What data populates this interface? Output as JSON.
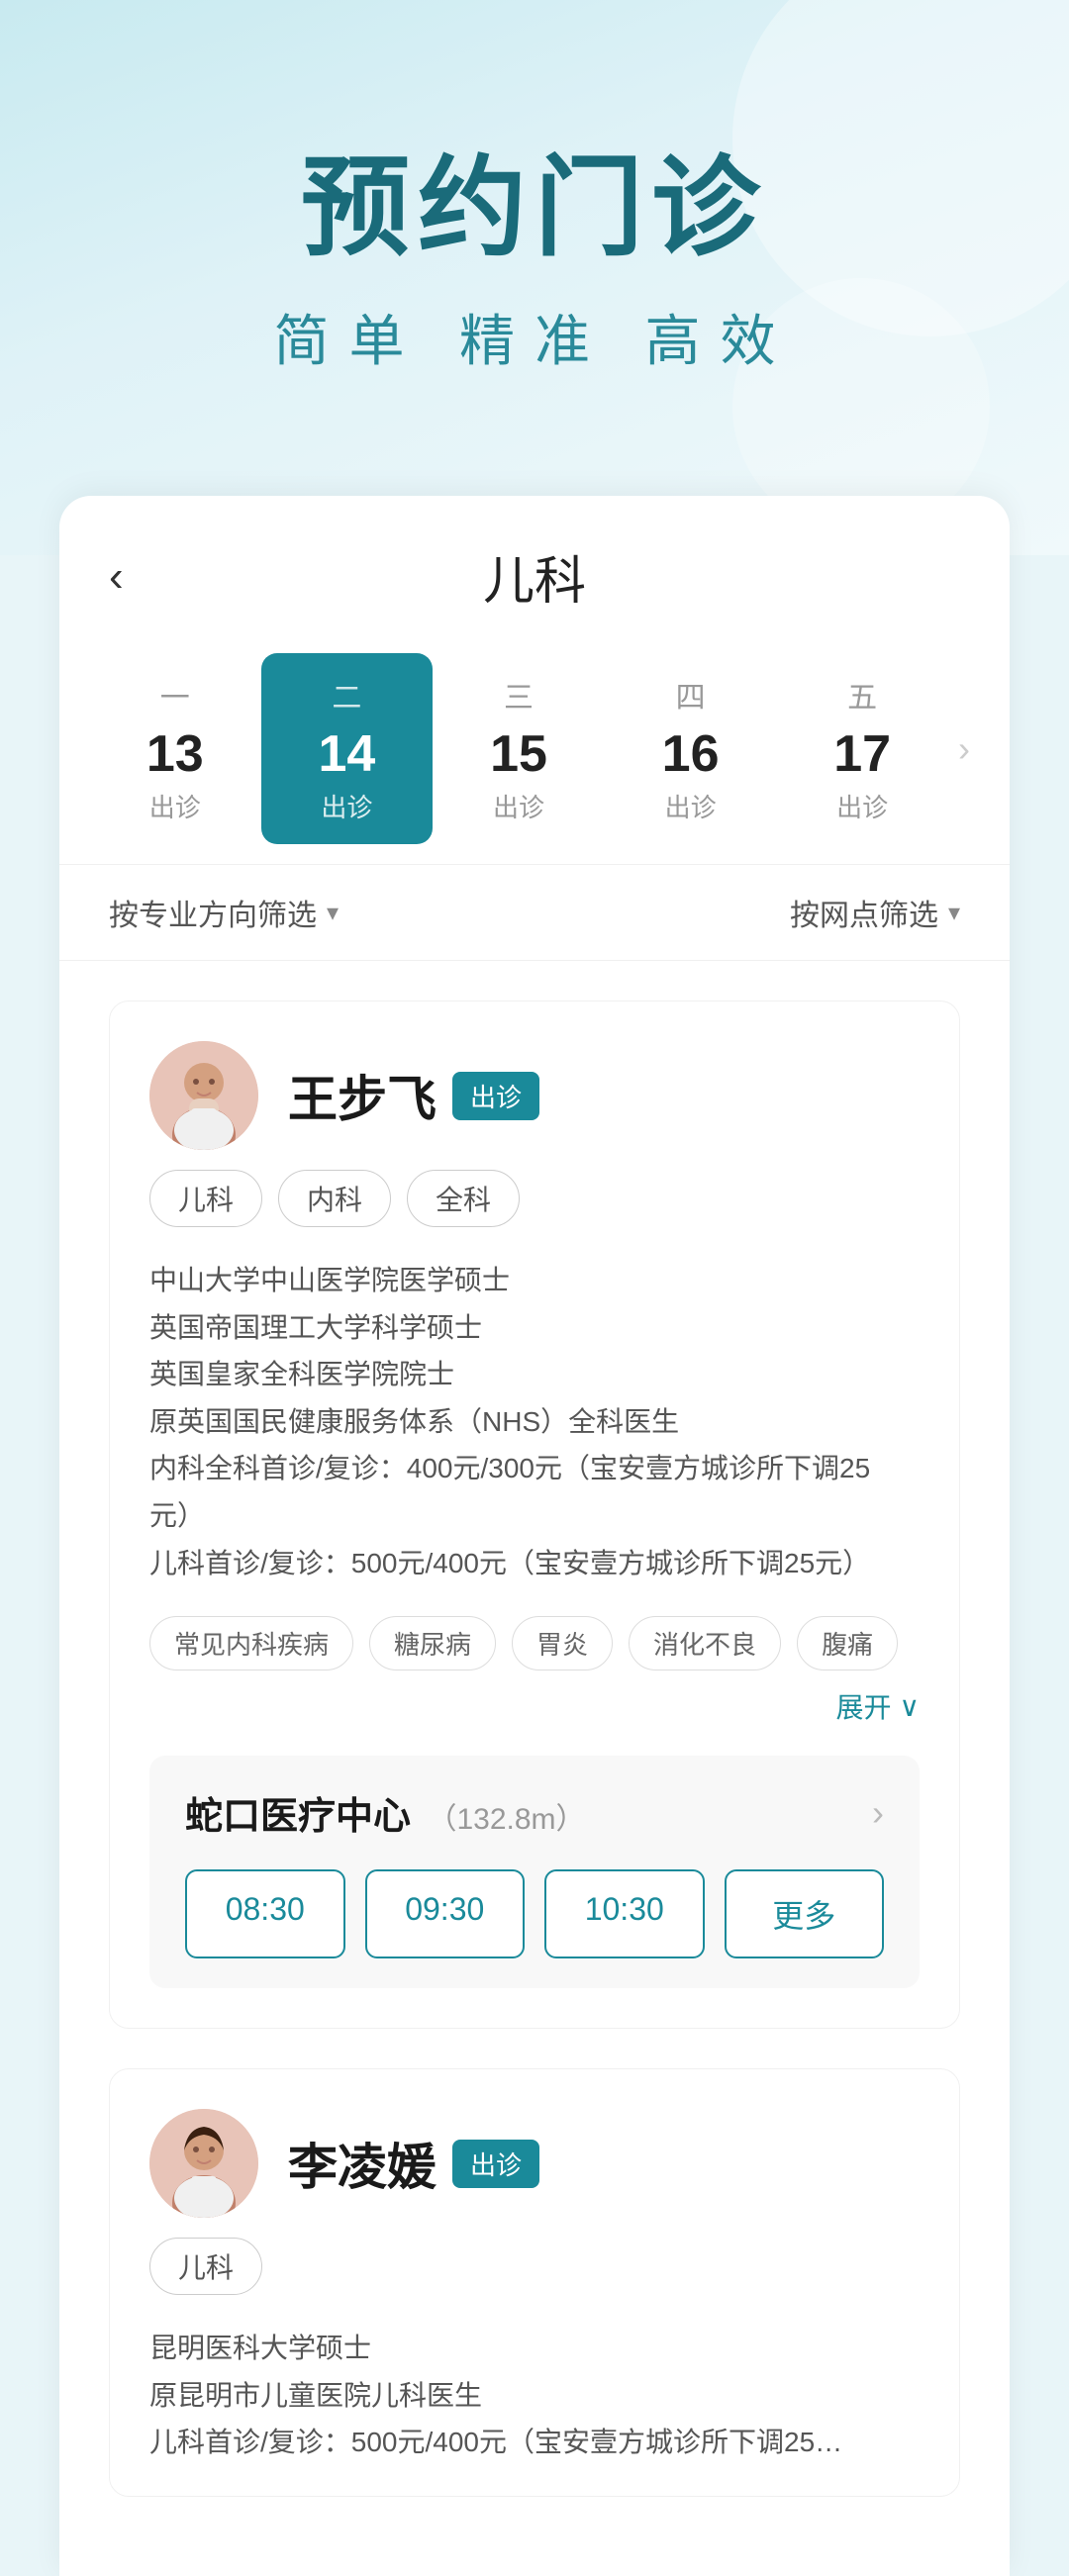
{
  "hero": {
    "title": "预约门诊",
    "subtitle": "简单 精准 高效"
  },
  "header": {
    "back_label": "‹",
    "title": "儿科"
  },
  "dates": [
    {
      "weekday": "一",
      "number": "13",
      "status": "出诊",
      "active": false
    },
    {
      "weekday": "二",
      "number": "14",
      "status": "出诊",
      "active": true
    },
    {
      "weekday": "三",
      "number": "15",
      "status": "出诊",
      "active": false
    },
    {
      "weekday": "四",
      "number": "16",
      "status": "出诊",
      "active": false
    },
    {
      "weekday": "五",
      "number": "17",
      "status": "出诊",
      "active": false
    }
  ],
  "filters": {
    "specialty": "按专业方向筛选",
    "location": "按网点筛选"
  },
  "doctors": [
    {
      "name": "王步飞",
      "status": "出诊",
      "tags": [
        "儿科",
        "内科",
        "全科"
      ],
      "desc": "中山大学中山医学院医学硕士\n英国帝国理工大学科学硕士\n英国皇家全科医学院院士\n原英国国民健康服务体系（NHS）全科医生\n内科全科首诊/复诊：400元/300元（宝安壹方城诊所下调25元）\n儿科首诊/复诊：500元/400元（宝安壹方城诊所下调25元）",
      "specialties": [
        "常见内科疾病",
        "糖尿病",
        "胃炎",
        "消化不良",
        "腹痛"
      ],
      "expand_label": "展开",
      "clinics": [
        {
          "name": "蛇口医疗中心",
          "distance": "（132.8m）",
          "slots": [
            "08:30",
            "09:30",
            "10:30",
            "更多"
          ]
        }
      ]
    },
    {
      "name": "李凌媛",
      "status": "出诊",
      "tags": [
        "儿科"
      ],
      "desc": "昆明医科大学硕士\n原昆明市儿童医院儿科医生\n儿科首诊/复诊：500元/400元（宝安壹方城诊所下调25..."
    }
  ]
}
